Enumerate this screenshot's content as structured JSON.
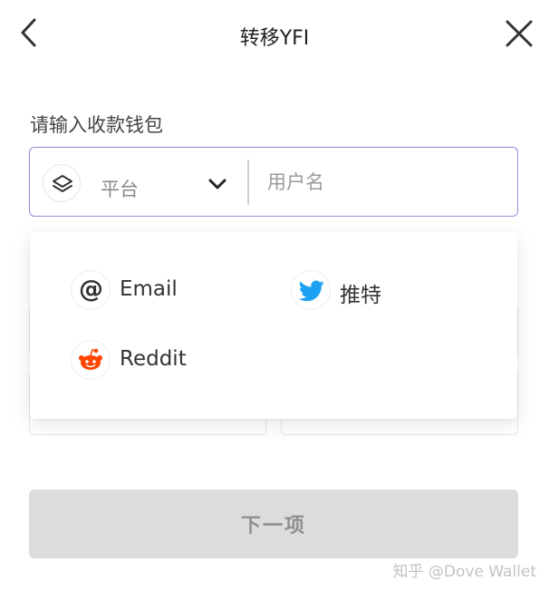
{
  "header": {
    "title": "转移YFI",
    "back_icon": "chevron-left-icon",
    "close_icon": "close-icon"
  },
  "form": {
    "label": "请输入收款钱包",
    "platform": {
      "selected": "平台",
      "icon": "layers-icon",
      "toggle_icon": "chevron-down-icon"
    },
    "username": {
      "placeholder": "用户名",
      "value": ""
    }
  },
  "dropdown": {
    "options": [
      {
        "label": "Email",
        "icon": "at-icon"
      },
      {
        "label": "推特",
        "icon": "twitter-icon",
        "color": "#1da1f2"
      },
      {
        "label": "Reddit",
        "icon": "reddit-icon",
        "color": "#ff4500"
      }
    ]
  },
  "actions": {
    "next_label": "下一项"
  },
  "watermark": "知乎 @Dove Wallet",
  "colors": {
    "input_border": "#8b8fd6",
    "button_disabled": "#dcdcdc",
    "twitter": "#1da1f2",
    "reddit": "#ff4500"
  }
}
